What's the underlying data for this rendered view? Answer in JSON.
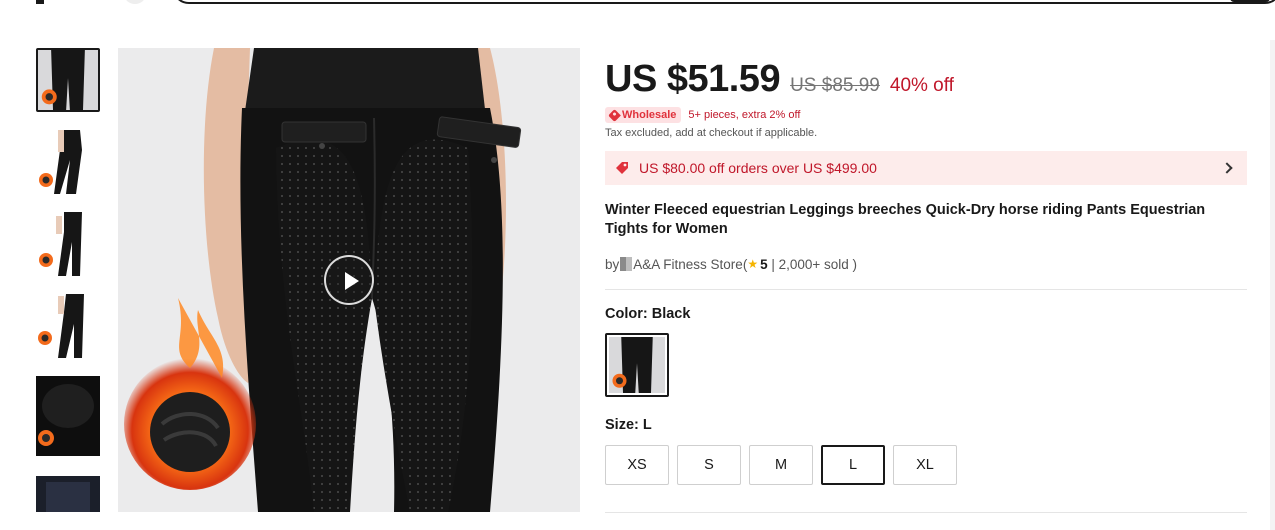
{
  "product": {
    "price": "US $51.59",
    "original_price": "US $85.99",
    "discount": "40% off",
    "wholesale_badge": "Wholesale",
    "wholesale_text": "5+ pieces, extra 2% off",
    "tax_note": "Tax excluded, add at checkout if applicable.",
    "coupon_text": "US $80.00 off orders over US $499.00",
    "title": "Winter Fleeced equestrian Leggings breeches Quick-Dry horse riding Pants Equestrian Tights for Women",
    "by_prefix": "by",
    "store_name": "A&A Fitness Store",
    "rating_open": " (",
    "rating": "5",
    "sold": " | 2,000+ sold )",
    "color_label": "Color:",
    "color_value": "Black",
    "size_label": "Size:",
    "size_value": "L",
    "sizes": [
      "XS",
      "S",
      "M",
      "L",
      "XL"
    ],
    "selected_size": "L"
  },
  "colors": {
    "price_red": "#c0172a",
    "coupon_bg": "#fdeceb",
    "badge_bg": "#fde1e3",
    "text_dark": "#191919",
    "star": "#f5b400"
  },
  "icons": {
    "play": "play-icon",
    "tag": "tag-icon",
    "coupon": "coupon-icon",
    "chevron": "chevron-right-icon",
    "star": "star-icon"
  }
}
